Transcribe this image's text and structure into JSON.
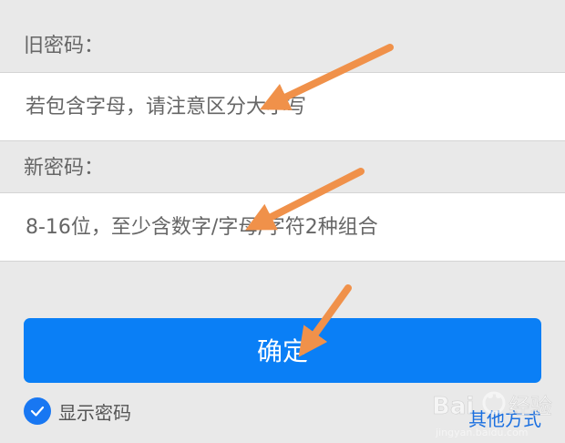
{
  "old_password": {
    "label": "旧密码：",
    "placeholder": "若包含字母，请注意区分大小写"
  },
  "new_password": {
    "label": "新密码：",
    "placeholder": "8-16位，至少含数字/字母/字符2种组合"
  },
  "confirm_label": "确定",
  "show_password_label": "显示密码",
  "show_password_checked": true,
  "other_method_label": "其他方式",
  "watermark_text": "Bai 经验",
  "colors": {
    "primary": "#0a7ff6",
    "link": "#1a6fe0",
    "arrow": "#f0914a",
    "background": "#e9e9e9"
  }
}
